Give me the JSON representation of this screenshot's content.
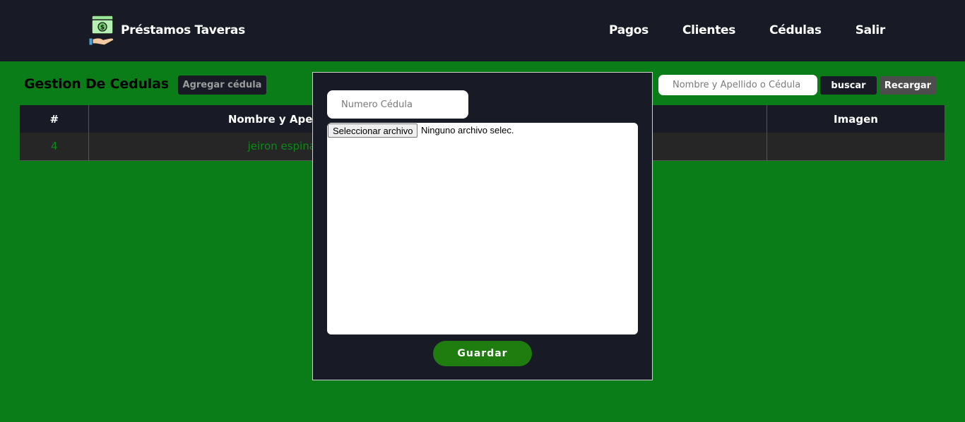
{
  "navbar": {
    "brand_title": "Préstamos Taveras",
    "logo_icon": "money-hand-icon",
    "links": [
      "Pagos",
      "Clientes",
      "Cédulas",
      "Salir"
    ]
  },
  "page": {
    "title": "Gestion De Cedulas",
    "add_label": "Agregar cédula",
    "search_placeholder": "Nombre y Apellido o Cédula",
    "search_label": "buscar",
    "reload_label": "Recargar"
  },
  "table": {
    "headers": [
      "#",
      "Nombre y Apellido",
      "",
      "Imagen"
    ],
    "rows": [
      {
        "id": "4",
        "name": "jeiron espinal",
        "cedula": "",
        "imagen": ""
      }
    ]
  },
  "modal": {
    "cedula_placeholder": "Numero Cédula",
    "file_button_label": "Seleccionar archivo",
    "file_status": "Ninguno archivo selec.",
    "save_label": "Guardar"
  },
  "colors": {
    "background": "#0b7d18",
    "navbar": "#181b25",
    "save_button": "#1e7d0e",
    "table_text": "#0b8a17"
  }
}
